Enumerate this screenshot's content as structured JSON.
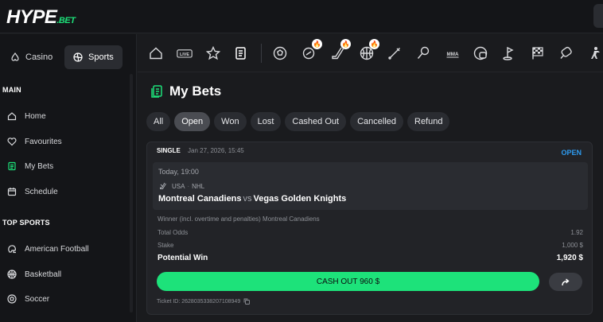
{
  "app": {
    "logo_main": "HYPE",
    "logo_suffix": ".BET"
  },
  "sidebar": {
    "toggle": [
      {
        "label": "Casino"
      },
      {
        "label": "Sports"
      }
    ],
    "main_title": "MAIN",
    "main_items": [
      {
        "label": "Home"
      },
      {
        "label": "Favourites"
      },
      {
        "label": "My Bets"
      },
      {
        "label": "Schedule"
      }
    ],
    "top_sports_title": "TOP SPORTS",
    "top_sports": [
      {
        "label": "American Football"
      },
      {
        "label": "Basketball"
      },
      {
        "label": "Soccer"
      }
    ]
  },
  "sportbar": {
    "live_label": "LIVE",
    "mma_label": "MMA"
  },
  "page": {
    "title": "My Bets"
  },
  "filters": [
    {
      "label": "All"
    },
    {
      "label": "Open"
    },
    {
      "label": "Won"
    },
    {
      "label": "Lost"
    },
    {
      "label": "Cashed Out"
    },
    {
      "label": "Cancelled"
    },
    {
      "label": "Refund"
    }
  ],
  "bet": {
    "type": "SINGLE",
    "date": "Jan 27, 2026, 15:45",
    "status": "OPEN",
    "event_time": "Today, 19:00",
    "country": "USA",
    "league_sep": "·",
    "league": "NHL",
    "home": "Montreal Canadiens",
    "vs": "vs",
    "away": "Vegas Golden Knights",
    "selection": "Winner (incl. overtime and penalties) Montreal Canadiens",
    "total_odds_label": "Total Odds",
    "total_odds": "1.92",
    "stake_label": "Stake",
    "stake": "1,000 $",
    "potential_win_label": "Potential Win",
    "potential_win": "1,920 $",
    "cashout_label": "CASH OUT 960 $",
    "ticket_id": "Ticket ID: 2628035338207108949"
  },
  "colors": {
    "accent": "#1de27a",
    "open_status": "#2d9bf0",
    "background": "#1a1b1e"
  }
}
